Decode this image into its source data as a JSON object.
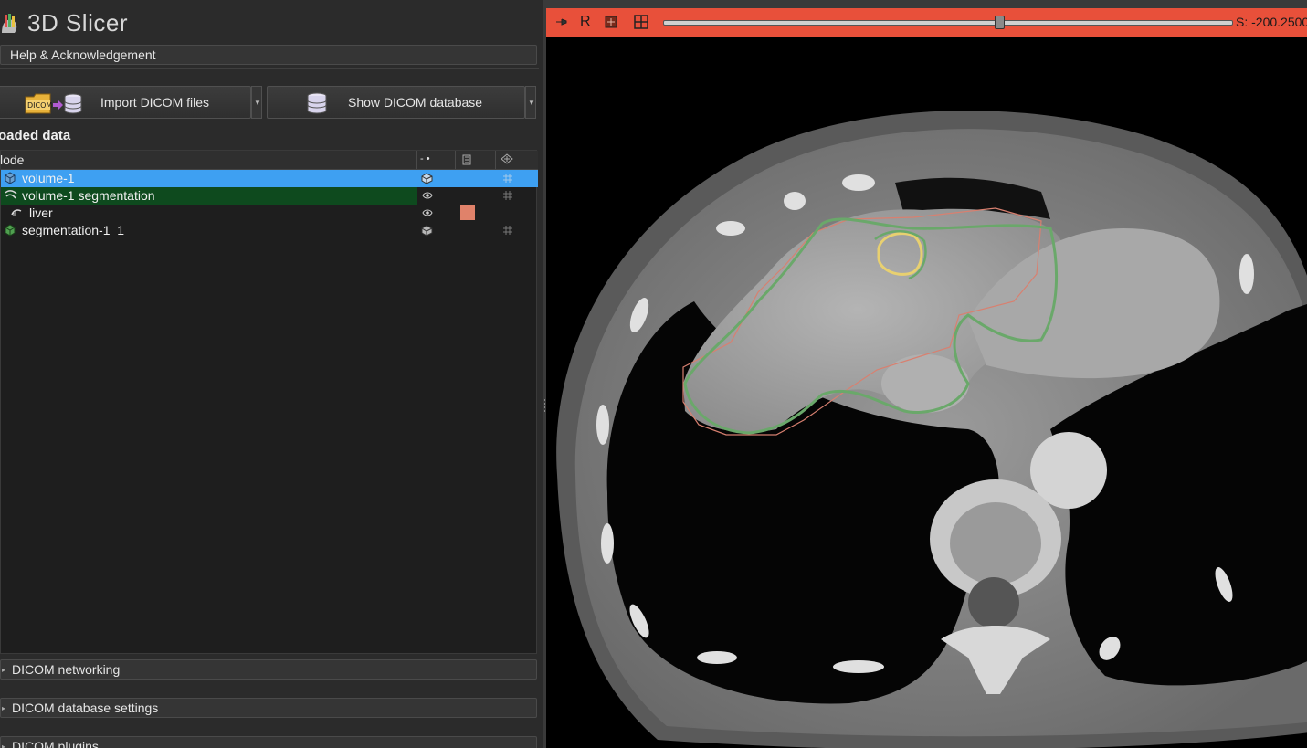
{
  "app": {
    "title": "3D Slicer"
  },
  "panels": {
    "help": "Help & Acknowledgement"
  },
  "buttons": {
    "import_dicom": "Import DICOM files",
    "show_database": "Show DICOM database",
    "import_icon_text": "DICOM"
  },
  "loaded_data": {
    "title": "oaded data",
    "columns": {
      "node": "lode",
      "visibility_symbol": "- •"
    },
    "rows": [
      {
        "label": "volume-1",
        "selected": true
      },
      {
        "label": "volume-1 segmentation",
        "highlighted": true
      },
      {
        "label": "liver",
        "color": "#e0826a"
      },
      {
        "label": "segmentation-1_1"
      }
    ]
  },
  "bottom_sections": [
    "DICOM networking",
    "DICOM database settings",
    "DICOM plugins"
  ],
  "slice_view": {
    "label": "R",
    "offset_text": "S: -200.2500",
    "bar_color": "#e8503a",
    "slider_position": 0.59
  },
  "colors": {
    "selection": "#3ea0f2",
    "segmentation_row": "#0e4a1e",
    "liver_outline": "#6aa86a",
    "tumor_outline": "#e8d070",
    "reference_outline": "#d88070"
  }
}
